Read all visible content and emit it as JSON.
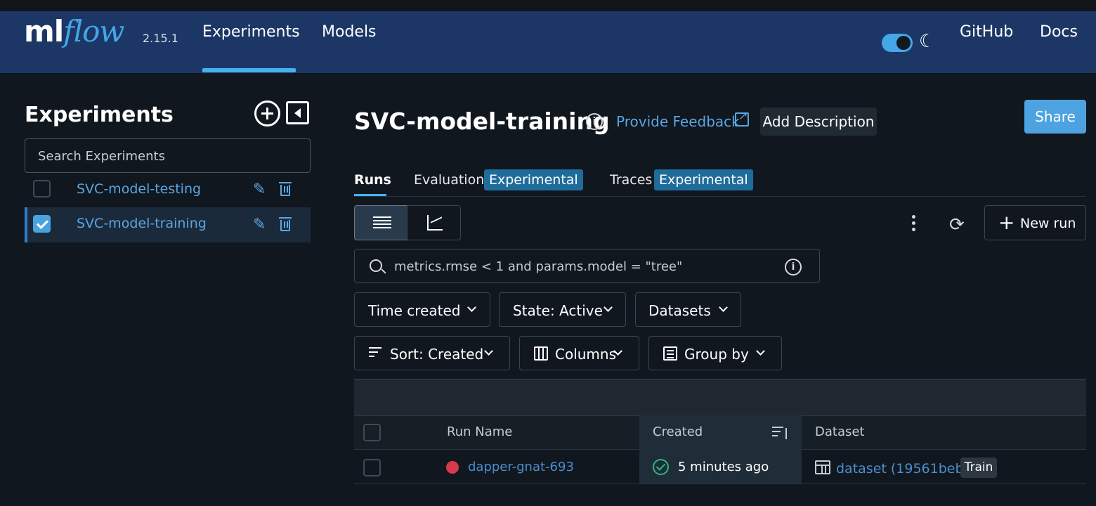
{
  "header": {
    "logo_ml": "ml",
    "logo_flow": "flow",
    "version": "2.15.1",
    "nav": [
      {
        "label": "Experiments",
        "active": true
      },
      {
        "label": "Models",
        "active": false
      }
    ],
    "links": {
      "github": "GitHub",
      "docs": "Docs"
    },
    "theme_toggle_on": true
  },
  "sidebar": {
    "title": "Experiments",
    "search_placeholder": "Search Experiments",
    "experiments": [
      {
        "name": "SVC-model-testing",
        "checked": false
      },
      {
        "name": "SVC-model-training",
        "checked": true
      }
    ]
  },
  "main": {
    "title": "SVC-model-training",
    "feedback": "Provide Feedback",
    "add_description": "Add Description",
    "share": "Share",
    "tabs": {
      "runs": "Runs",
      "evaluation": "Evaluation",
      "traces": "Traces",
      "badge": "Experimental"
    },
    "new_run": "New run",
    "filter_placeholder": "metrics.rmse < 1 and params.model = \"tree\"",
    "dropdowns": {
      "time_created": "Time created",
      "state": "State: Active",
      "datasets": "Datasets",
      "sort": "Sort: Created",
      "columns": "Columns",
      "group_by": "Group by"
    },
    "table": {
      "headers": {
        "run_name": "Run Name",
        "created": "Created",
        "dataset": "Dataset"
      },
      "rows": [
        {
          "run_name": "dapper-gnat-693",
          "created": "5 minutes ago",
          "dataset": "dataset (19561beb)",
          "dataset_tag": "Train",
          "status_color": "#d63a4e"
        }
      ]
    }
  },
  "colors": {
    "header_bg": "#1c3766",
    "accent": "#43b3f0",
    "link": "#5aa6e4",
    "share_bg": "#4da3e1",
    "success": "#2fb77a"
  }
}
